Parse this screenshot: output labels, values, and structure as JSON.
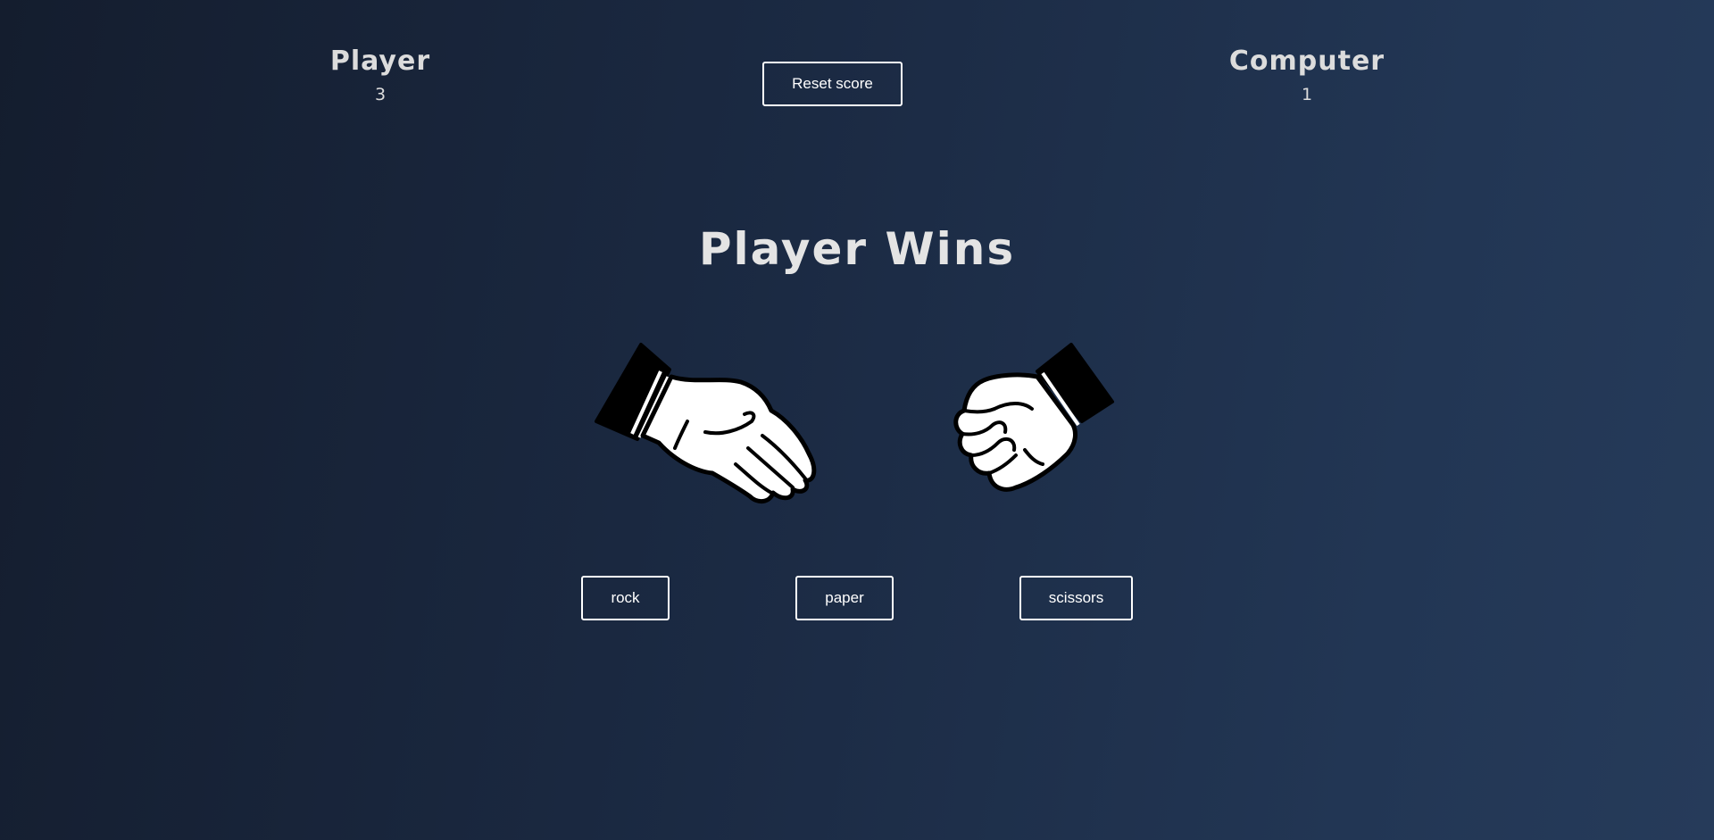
{
  "player": {
    "title": "Player",
    "score": "3"
  },
  "computer": {
    "title": "Computer",
    "score": "1"
  },
  "reset_label": "Reset score",
  "result_text": "Player Wins",
  "player_hand_icon": "paper-hand-icon",
  "computer_hand_icon": "rock-fist-icon",
  "choices": [
    {
      "label": "rock"
    },
    {
      "label": "paper"
    },
    {
      "label": "scissors"
    }
  ],
  "colors": {
    "background_start": "#141d2e",
    "background_end": "#263b5a",
    "text": "#e0e0e0",
    "button_border": "#ffffff"
  }
}
